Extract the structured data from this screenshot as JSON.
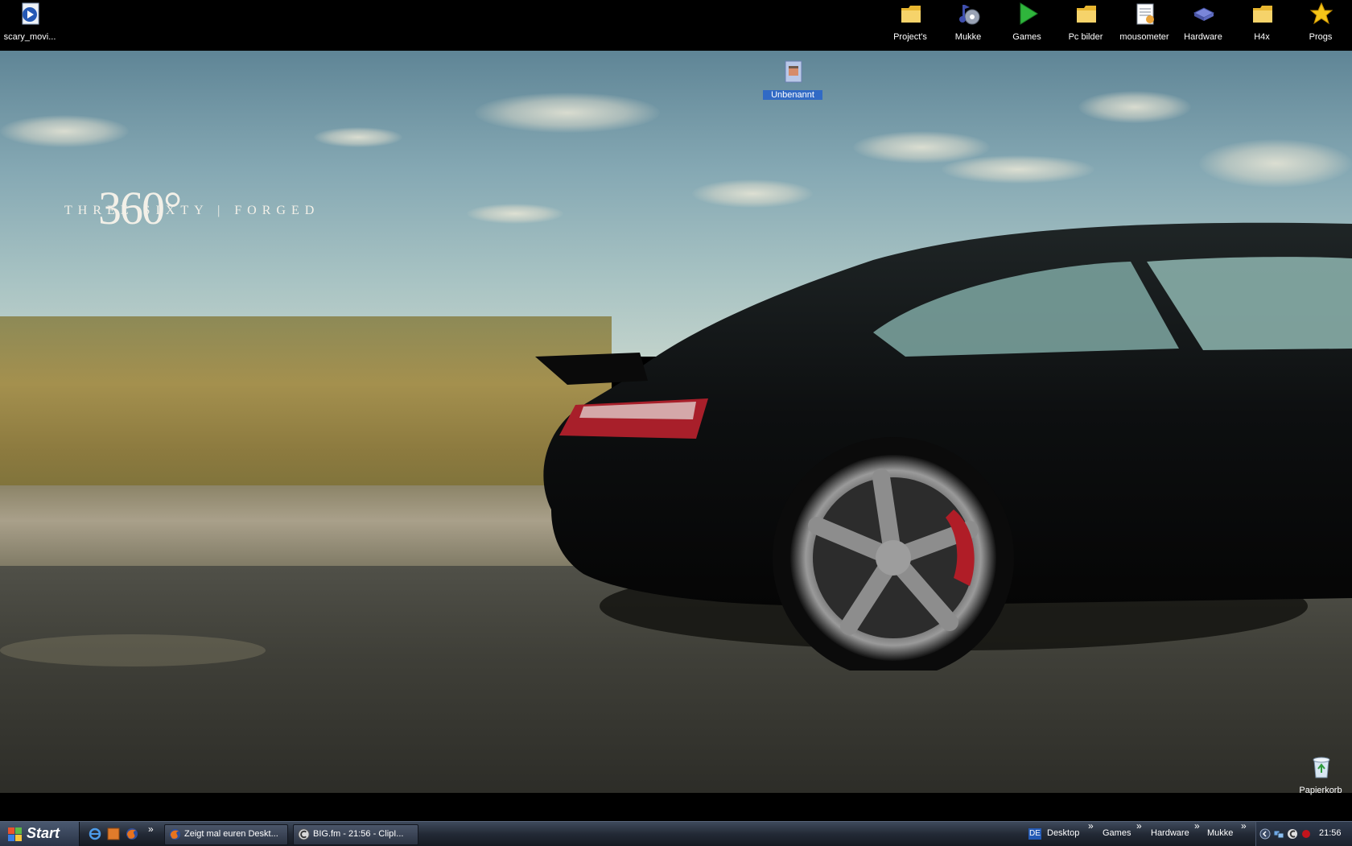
{
  "desktop": {
    "icons": [
      {
        "label": "scary_movi...",
        "icon": "media-file-icon"
      },
      {
        "label": "Project's",
        "icon": "folder-icon"
      },
      {
        "label": "Mukke",
        "icon": "music-icon"
      },
      {
        "label": "Games",
        "icon": "play-icon"
      },
      {
        "label": "Pc bilder",
        "icon": "folder-icon"
      },
      {
        "label": "mousometer",
        "icon": "notepad-icon"
      },
      {
        "label": "Hardware",
        "icon": "hardware-icon"
      },
      {
        "label": "H4x",
        "icon": "folder-icon"
      },
      {
        "label": "Progs",
        "icon": "star-icon"
      },
      {
        "label": "Unbenannt",
        "icon": "image-file-icon",
        "selected": true
      },
      {
        "label": "Papierkorb",
        "icon": "recycle-bin-icon"
      }
    ],
    "wallpaper": {
      "logo_number": "360°",
      "logo_text": "THREE SIXTY | FORGED"
    }
  },
  "taskbar": {
    "start_label": "Start",
    "quick_launch": [
      "internet-explorer-icon",
      "app-icon",
      "firefox-icon"
    ],
    "quick_launch_more": "»",
    "windows": [
      {
        "label": "Zeigt mal euren Deskt...",
        "icon": "firefox-icon"
      },
      {
        "label": "BIG.fm - 21:56 - ClipI...",
        "icon": "clipinc-icon"
      }
    ],
    "tray": {
      "language": "DE",
      "toolbars": [
        "Desktop",
        "Games",
        "Hardware",
        "Mukke"
      ],
      "chevron": "»",
      "clock": "21:56"
    }
  },
  "colors": {
    "taskbar": "#232a36",
    "selection": "#316ac5",
    "folder": "#f2c94c"
  }
}
